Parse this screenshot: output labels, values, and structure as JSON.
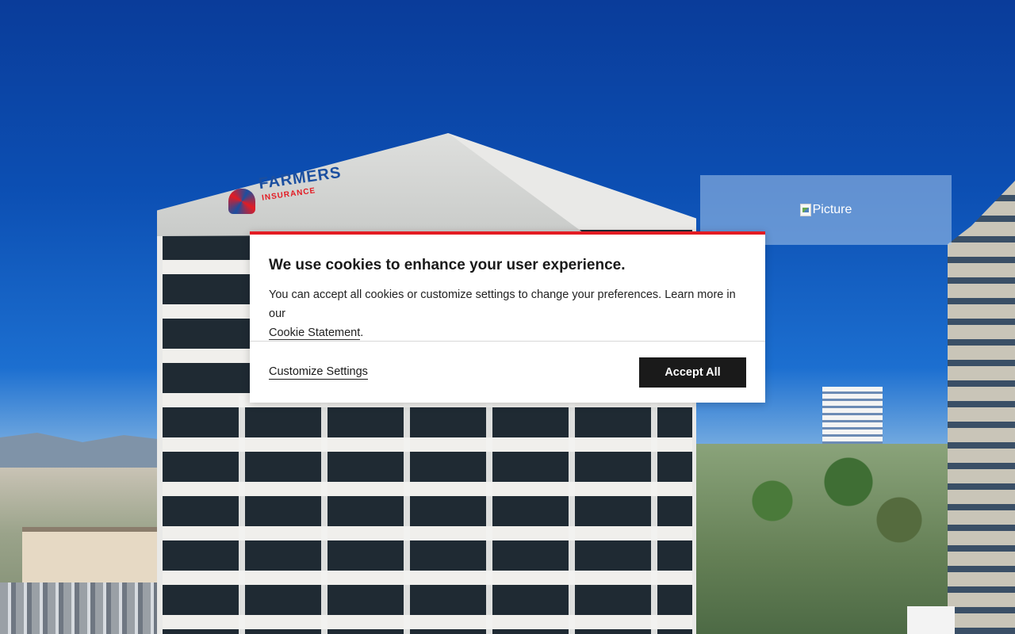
{
  "background": {
    "logo_text": "FARMERS",
    "logo_subtext": "INSURANCE"
  },
  "picture": {
    "alt_text": "Picture"
  },
  "cookie_dialog": {
    "title": "We use cookies to enhance your user experience.",
    "body_text": "You can accept all cookies or customize settings to change your preferences. Learn more in our",
    "link_text": "Cookie Statement",
    "trailing_punctuation": ".",
    "customize_label": "Customize Settings",
    "accept_label": "Accept All",
    "accent_color": "#e31b23",
    "button_color": "#1a1a1a"
  }
}
